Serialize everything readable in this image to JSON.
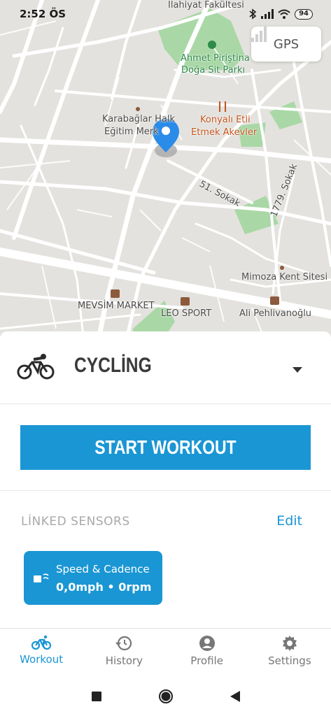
{
  "status_bar": {
    "time": "2:52 ÖS",
    "battery": "94"
  },
  "map": {
    "gps_label": "GPS",
    "labels": {
      "faculty": "İlahiyat Fakültesi",
      "park_line1": "Ahmet Piriştina",
      "park_line2": "Doğa Sit Parkı",
      "karabaglar_line1": "Karabağlar Halk",
      "karabaglar_line2": "Eğitim Merk",
      "konyali_line1": "Konyalı Etli",
      "konyali_line2": "Etmek Akevler",
      "street_51": "51. Sokak",
      "street_1779": "1779. Sokak",
      "mimoza": "Mimoza Kent Sitesi",
      "mevsim": "MEVSİM MARKET",
      "leo": "LEO SPORT",
      "ali": "Ali Pehlivanoğlu"
    }
  },
  "activity": {
    "name": "CYCLİNG",
    "icon": "bicycle-icon"
  },
  "start_button": {
    "label": "START WORKOUT"
  },
  "colors": {
    "accent": "#1a96d4"
  },
  "sensors": {
    "title": "LİNKED SENSORS",
    "edit_label": "Edit",
    "items": [
      {
        "name": "Speed & Cadence",
        "values": "0,0mph • 0rpm",
        "icon": "sensor-icon"
      }
    ]
  },
  "nav": {
    "items": [
      {
        "label": "Workout",
        "icon": "bicycle-icon",
        "active": true
      },
      {
        "label": "History",
        "icon": "history-icon",
        "active": false
      },
      {
        "label": "Profile",
        "icon": "profile-icon",
        "active": false
      },
      {
        "label": "Settings",
        "icon": "gear-icon",
        "active": false
      }
    ]
  }
}
